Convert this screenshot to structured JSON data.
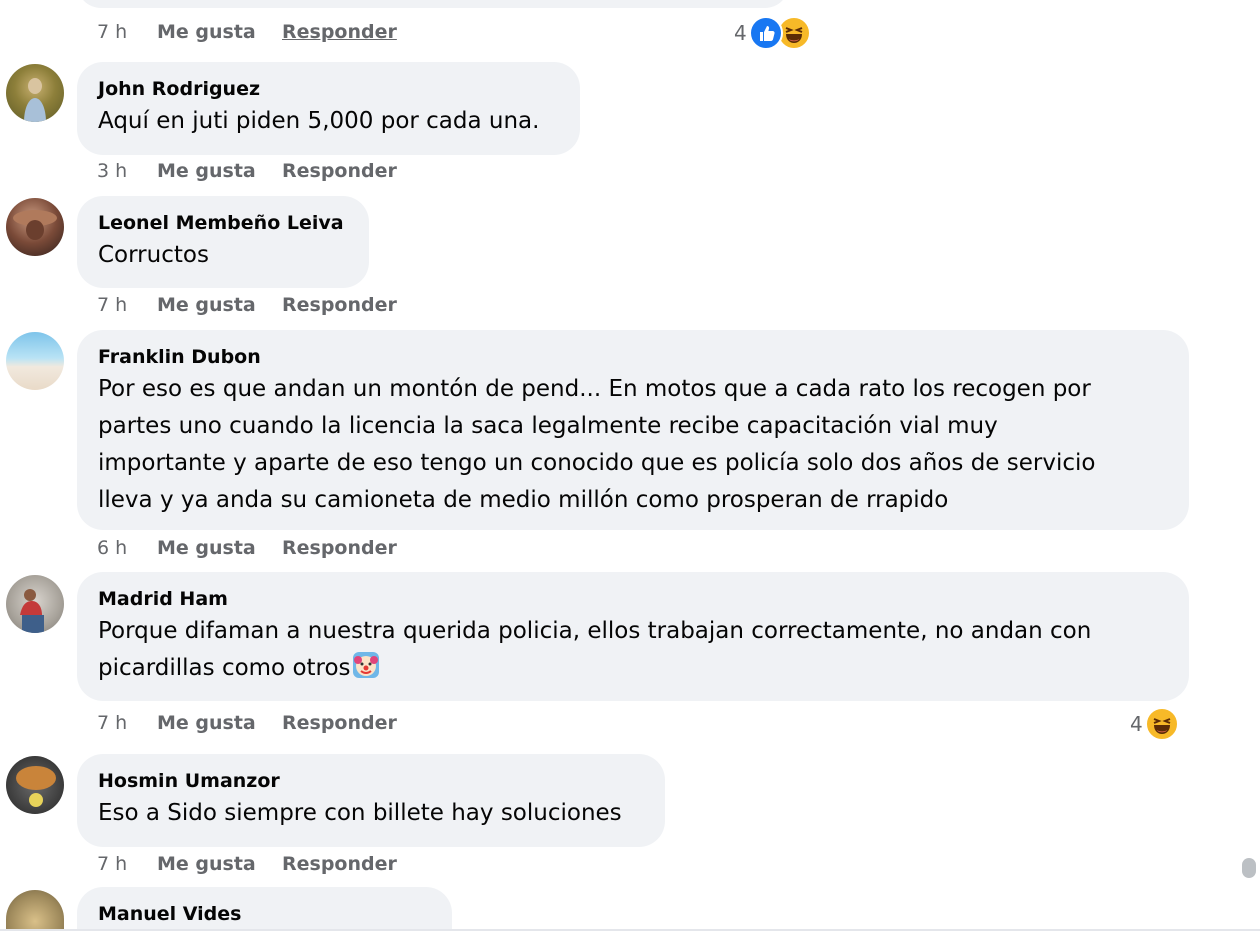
{
  "top_comment": {
    "time": "7 h",
    "like_label": "Me gusta",
    "reply_label": "Responder",
    "reaction_count": "4",
    "reactions": [
      "like-icon",
      "haha-icon"
    ]
  },
  "comments": [
    {
      "author": "John Rodriguez",
      "text": "Aquí en juti piden 5,000 por cada una.",
      "time": "3 h",
      "like_label": "Me gusta",
      "reply_label": "Responder"
    },
    {
      "author": "Leonel Membeño Leiva",
      "text": "Corructos",
      "time": "7 h",
      "like_label": "Me gusta",
      "reply_label": "Responder"
    },
    {
      "author": "Franklin Dubon",
      "text_lines": [
        "Por eso es que andan un montón de pend... En motos que a cada rato los recogen por",
        "partes uno cuando la licencia la saca legalmente recibe capacitación vial muy",
        "importante y aparte de eso tengo un conocido que es policía solo dos años de servicio",
        "lleva y ya anda su camioneta de medio millón como prosperan de rrapido"
      ],
      "time": "6 h",
      "like_label": "Me gusta",
      "reply_label": "Responder"
    },
    {
      "author": "Madrid Ham",
      "text_lines": [
        "Porque difaman a nuestra querida policia, ellos trabajan correctamente, no andan con",
        "picardillas como otros"
      ],
      "inline_emoji": "clown-face-icon",
      "time": "7 h",
      "like_label": "Me gusta",
      "reply_label": "Responder",
      "reaction_count": "4",
      "reactions": [
        "haha-icon"
      ]
    },
    {
      "author": "Hosmin Umanzor",
      "text": "Eso a Sido siempre con billete hay soluciones",
      "time": "7 h",
      "like_label": "Me gusta",
      "reply_label": "Responder"
    },
    {
      "author": "Manuel Vides"
    }
  ],
  "colors": {
    "bubble_bg": "#f0f2f5",
    "meta_text": "#65676b",
    "like_blue": "#1877f2",
    "haha_yellow": "#f7b928"
  }
}
